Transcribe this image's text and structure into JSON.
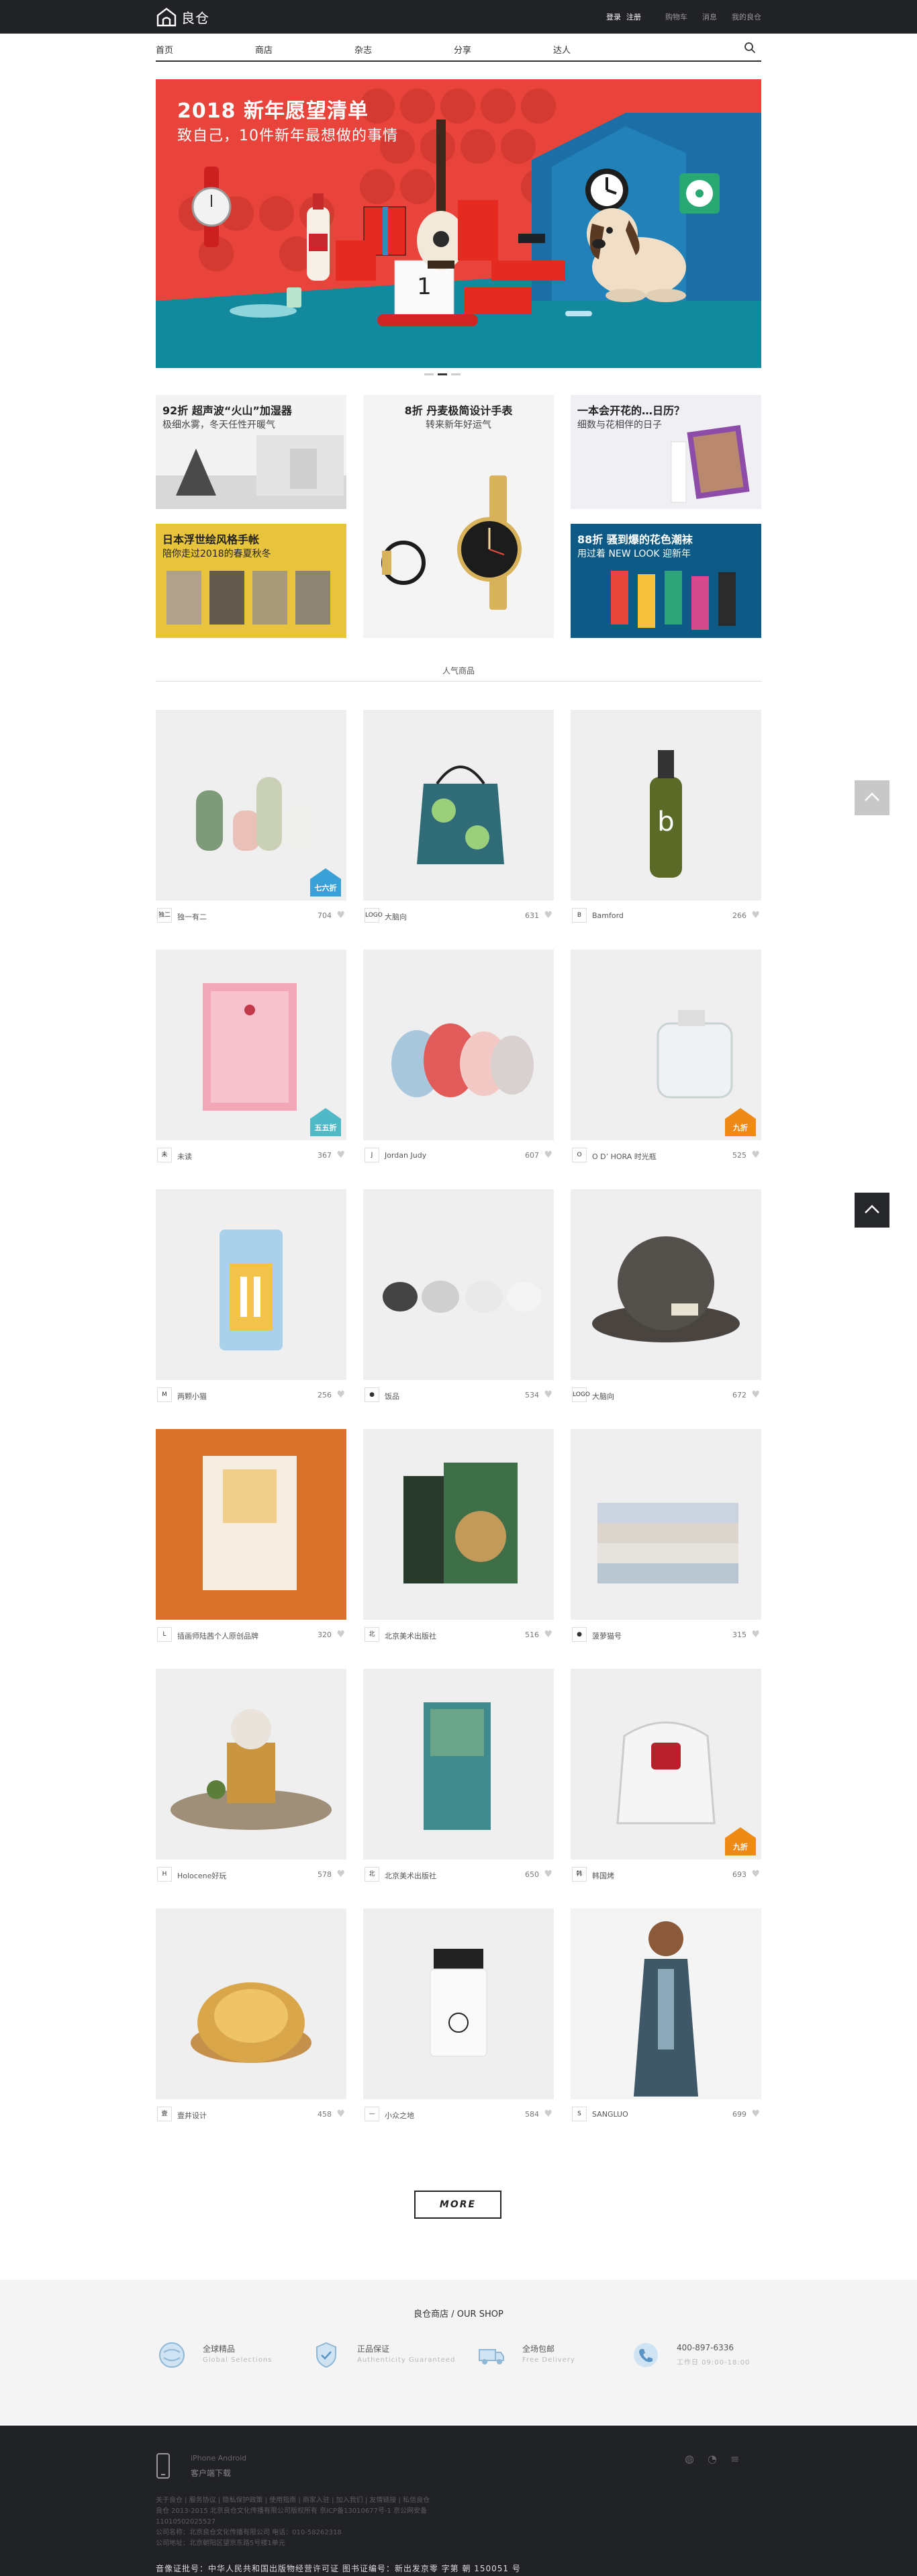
{
  "topbar": {
    "logo_text": "良仓",
    "login": "登录",
    "register": "注册",
    "cart": "购物车",
    "messages": "消息",
    "orders": "我的良仓"
  },
  "nav": {
    "items": [
      "首页",
      "商店",
      "杂志",
      "分享",
      "达人"
    ]
  },
  "banner": {
    "title": "2018 新年愿望清单",
    "subtitle": "致自己，10件新年最想做的事情"
  },
  "promos": [
    {
      "title": "92折 超声波“火山”加湿器",
      "subtitle": "极细水雾，冬天任性开暖气"
    },
    {
      "title": "8折 丹麦极简设计手表",
      "subtitle": "转来新年好运气"
    },
    {
      "title": "一本会开花的…日历？",
      "subtitle": "细数与花相伴的日子"
    },
    {
      "title": "日本浮世绘风格手帐",
      "subtitle": "陪你走过2018的春夏秋冬"
    },
    {
      "title": "88折 骚到爆的花色潮袜",
      "subtitle": "用过着 NEW LOOK 迎新年"
    }
  ],
  "section": {
    "title": "人气商品"
  },
  "products": [
    {
      "brand": "独一有二",
      "likes": "704",
      "badge": "七六折",
      "logo": "独二"
    },
    {
      "brand": "大脑向",
      "likes": "631",
      "badge": "",
      "logo": "LOGO"
    },
    {
      "brand": "Bamford",
      "likes": "266",
      "badge": "",
      "logo": "B"
    },
    {
      "brand": "未读",
      "likes": "367",
      "badge": "五五折",
      "logo": "未"
    },
    {
      "brand": "Jordan Judy",
      "likes": "607",
      "badge": "",
      "logo": "J"
    },
    {
      "brand": "O D’ HORA 时光瓶",
      "likes": "525",
      "badge": "九折",
      "logo": "O"
    },
    {
      "brand": "两颗小猫",
      "likes": "256",
      "badge": "",
      "logo": "M"
    },
    {
      "brand": "饭品",
      "likes": "534",
      "badge": "",
      "logo": "●"
    },
    {
      "brand": "大脑向",
      "likes": "672",
      "badge": "",
      "logo": "LOGO"
    },
    {
      "brand": "插画师陆茜个人原创品牌",
      "likes": "320",
      "badge": "",
      "logo": "L"
    },
    {
      "brand": "北京美术出版社",
      "likes": "516",
      "badge": "",
      "logo": "北"
    },
    {
      "brand": "菠萝猫号",
      "likes": "315",
      "badge": "",
      "logo": "●"
    },
    {
      "brand": "Holocene好玩",
      "likes": "578",
      "badge": "",
      "logo": "H"
    },
    {
      "brand": "北京美术出版社",
      "likes": "650",
      "badge": "",
      "logo": "北"
    },
    {
      "brand": "韩国烤",
      "likes": "693",
      "badge": "九折",
      "logo": "韩"
    },
    {
      "brand": "壹井设计",
      "likes": "458",
      "badge": "",
      "logo": "壹"
    },
    {
      "brand": "小众之地",
      "likes": "584",
      "badge": "",
      "logo": "—"
    },
    {
      "brand": "SANGLUO",
      "likes": "699",
      "badge": "",
      "logo": "S"
    }
  ],
  "more_label": "MORE",
  "shop": {
    "title": "良仓商店 / OUR SHOP",
    "features": [
      {
        "title": "全球精品",
        "sub": "Global Selections"
      },
      {
        "title": "正品保证",
        "sub": "Authenticity Guaranteed"
      },
      {
        "title": "全场包邮",
        "sub": "Free Delivery"
      },
      {
        "title": "400-897-6336",
        "sub": "工作日 09:00-18:00"
      }
    ]
  },
  "footer": {
    "app_platforms": "iPhone Android",
    "app_download": "客户端下载",
    "links": [
      "关于良仓 | 服务协议 | 隐私保护政策 | 使用指南 | 商家入驻 | 加入我们 | 友情链接 | 私信良仓",
      "良仓 2013-2015 北京良仓文化传播有限公司版权所有 京ICP备13010677号-1 京公网安备",
      "11010502025527",
      "公司名称：北京良仓文化传播有限公司 电话：010-58262318",
      "公司地址：北京朝阳区望京东路5号楼1单元"
    ],
    "license": "音像证批号：中华人民共和国出版物经营许可证  图书证编号：新出发京零 字第 朝 150051 号"
  },
  "colors": {
    "topbar_bg": "#212226",
    "banner_red": "#e8443b",
    "banner_teal": "#0d8ea0",
    "badge_blue": "#3aa0d8",
    "badge_orange": "#ef8a17",
    "badge_teal": "#4fb9c8"
  },
  "icons": [
    "logo-house-icon",
    "search-icon",
    "heart-icon",
    "scroll-up-icon",
    "back-to-top-icon",
    "phone-icon",
    "globe-icon",
    "shield-icon",
    "truck-icon",
    "telephone-icon",
    "weibo-icon",
    "wechat-icon",
    "menu-icon"
  ]
}
